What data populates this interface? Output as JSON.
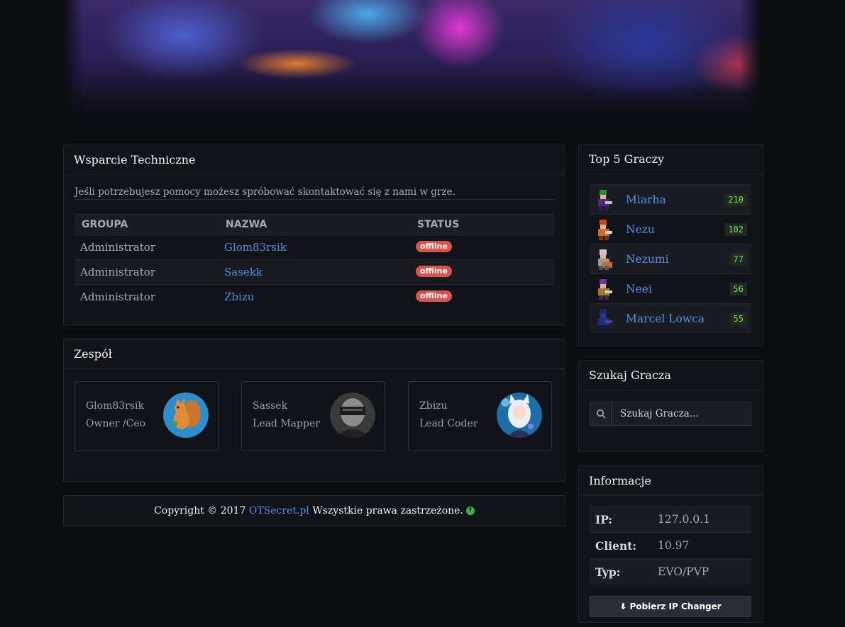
{
  "support": {
    "title": "Wsparcie Techniczne",
    "intro": "Jeśli potrzebujesz pomocy możesz spróbować skontaktować się z nami w grze.",
    "columns": [
      "GROUPA",
      "NAZWA",
      "STATUS"
    ],
    "rows": [
      {
        "group": "Administrator",
        "name": "Glom83rsik",
        "status": "offline"
      },
      {
        "group": "Administrator",
        "name": "Sasekk",
        "status": "offline"
      },
      {
        "group": "Administrator",
        "name": "Zbizu",
        "status": "offline"
      }
    ]
  },
  "team": {
    "title": "Zespół",
    "members": [
      {
        "name": "Glom83rsik",
        "role": "Owner /Ceo",
        "avatar": "squirrel-avatar"
      },
      {
        "name": "Sassek",
        "role": "Lead Mapper",
        "avatar": "masked-person-avatar"
      },
      {
        "name": "Zbizu",
        "role": "Lead Coder",
        "avatar": "anime-girl-avatar"
      }
    ]
  },
  "footer": {
    "prefix": "Copyright © 2017",
    "site": "OTSecret.pl",
    "suffix": "Wszystkie prawa zastrzeżone."
  },
  "top5": {
    "title": "Top 5 Graczy",
    "players": [
      {
        "name": "Miarha",
        "level": "210"
      },
      {
        "name": "Nezu",
        "level": "102"
      },
      {
        "name": "Nezumi",
        "level": "77"
      },
      {
        "name": "Neei",
        "level": "56"
      },
      {
        "name": "Marcel Lowca",
        "level": "55"
      }
    ]
  },
  "search": {
    "title": "Szukaj Gracza",
    "placeholder": "Szukaj Gracza..."
  },
  "info": {
    "title": "Informacje",
    "rows": [
      {
        "key": "IP:",
        "value": "127.0.0.1"
      },
      {
        "key": "Client:",
        "value": "10.97"
      },
      {
        "key": "Typ:",
        "value": "EVO/PVP"
      }
    ],
    "button": "Pobierz IP Changer"
  },
  "colors": {
    "background": "#0c0d11",
    "panel": "#111319",
    "link": "#4f8fe6",
    "badge_offline": "#d9534f",
    "level_text": "#7ed957"
  }
}
